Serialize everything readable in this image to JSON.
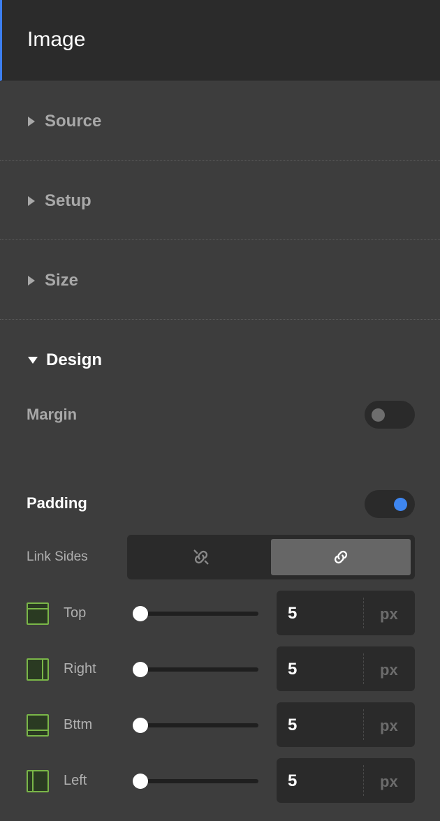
{
  "header": {
    "title": "Image"
  },
  "sections": {
    "source": "Source",
    "setup": "Setup",
    "size": "Size",
    "design": "Design"
  },
  "margin": {
    "label": "Margin",
    "enabled": false
  },
  "padding": {
    "label": "Padding",
    "enabled": true,
    "link_sides_label": "Link Sides",
    "link_options": [
      "unlink-icon",
      "link-icon"
    ],
    "link_selected": "link-icon",
    "sides": [
      {
        "label": "Top",
        "value": "5",
        "unit": "px"
      },
      {
        "label": "Right",
        "value": "5",
        "unit": "px"
      },
      {
        "label": "Bttm",
        "value": "5",
        "unit": "px"
      },
      {
        "label": "Left",
        "value": "5",
        "unit": "px"
      }
    ]
  },
  "colors": {
    "accent": "#3e86f0",
    "side_icon": "#7ab648"
  }
}
